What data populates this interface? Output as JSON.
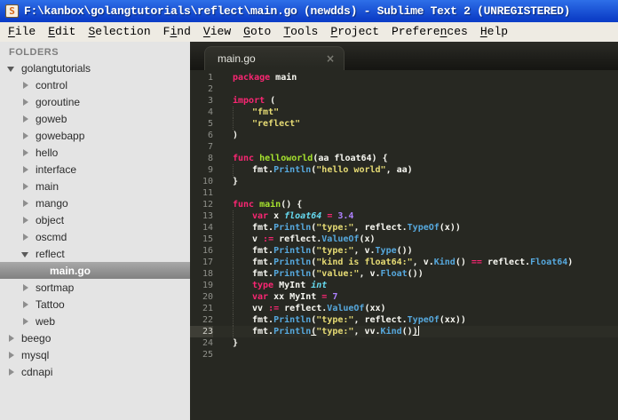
{
  "colors": {
    "titlebar-blue-top": "#2e6fe8",
    "titlebar-blue-bottom": "#0d3fc8",
    "menubar-bg": "#eeebe3",
    "sidebar-bg": "#e4e4e4",
    "sidebar-selected-top": "#a8a8a8",
    "sidebar-selected-bottom": "#818181",
    "editor-bg": "#272822",
    "keyword": "#f92672",
    "string": "#e6db74",
    "function-decl": "#a6e22e",
    "function-call": "#56a8dd",
    "type-italic": "#66d9ef",
    "number": "#ae81ff",
    "default-text": "#f8f8f2",
    "line-number": "#8f908a"
  },
  "window": {
    "icon_letter": "S",
    "title": "F:\\kanbox\\golangtutorials\\reflect\\main.go (newdds) - Sublime Text 2 (UNREGISTERED)"
  },
  "menu": {
    "items": [
      {
        "label": "File",
        "u": 0
      },
      {
        "label": "Edit",
        "u": 0
      },
      {
        "label": "Selection",
        "u": 0
      },
      {
        "label": "Find",
        "u": 1
      },
      {
        "label": "View",
        "u": 0
      },
      {
        "label": "Goto",
        "u": 0
      },
      {
        "label": "Tools",
        "u": 0
      },
      {
        "label": "Project",
        "u": 0
      },
      {
        "label": "Preferences",
        "u": 7
      },
      {
        "label": "Help",
        "u": 0
      }
    ]
  },
  "sidebar": {
    "header": "FOLDERS",
    "items": [
      {
        "label": "golangtutorials",
        "level": 0,
        "state": "expanded"
      },
      {
        "label": "control",
        "level": 1,
        "state": "collapsed"
      },
      {
        "label": "goroutine",
        "level": 1,
        "state": "collapsed"
      },
      {
        "label": "goweb",
        "level": 1,
        "state": "collapsed"
      },
      {
        "label": "gowebapp",
        "level": 1,
        "state": "collapsed"
      },
      {
        "label": "hello",
        "level": 1,
        "state": "collapsed"
      },
      {
        "label": "interface",
        "level": 1,
        "state": "collapsed"
      },
      {
        "label": "main",
        "level": 1,
        "state": "collapsed"
      },
      {
        "label": "mango",
        "level": 1,
        "state": "collapsed"
      },
      {
        "label": "object",
        "level": 1,
        "state": "collapsed"
      },
      {
        "label": "oscmd",
        "level": 1,
        "state": "collapsed"
      },
      {
        "label": "reflect",
        "level": 1,
        "state": "expanded"
      },
      {
        "label": "main.go",
        "level": 2,
        "state": "file",
        "selected": true
      },
      {
        "label": "sortmap",
        "level": 1,
        "state": "collapsed"
      },
      {
        "label": "Tattoo",
        "level": 1,
        "state": "collapsed"
      },
      {
        "label": "web",
        "level": 1,
        "state": "collapsed"
      },
      {
        "label": "beego",
        "level": 0,
        "state": "collapsed"
      },
      {
        "label": "mysql",
        "level": 0,
        "state": "collapsed"
      },
      {
        "label": "cdnapi",
        "level": 0,
        "state": "collapsed"
      }
    ]
  },
  "editor": {
    "tabs": [
      {
        "label": "main.go",
        "close_icon": "×",
        "active": true
      }
    ],
    "code": {
      "lines": [
        {
          "n": 1,
          "tokens": [
            [
              "kw",
              "package"
            ],
            [
              "pl",
              " main"
            ]
          ]
        },
        {
          "n": 2,
          "tokens": []
        },
        {
          "n": 3,
          "tokens": [
            [
              "kw",
              "import"
            ],
            [
              "pl",
              " ("
            ]
          ]
        },
        {
          "n": 4,
          "indent": 1,
          "tokens": [
            [
              "str",
              "\"fmt\""
            ]
          ]
        },
        {
          "n": 5,
          "indent": 1,
          "tokens": [
            [
              "str",
              "\"reflect\""
            ]
          ]
        },
        {
          "n": 6,
          "tokens": [
            [
              "pl",
              ")"
            ]
          ]
        },
        {
          "n": 7,
          "tokens": []
        },
        {
          "n": 8,
          "tokens": [
            [
              "kw",
              "func"
            ],
            [
              "fndecl",
              " helloworld"
            ],
            [
              "pl",
              "(aa float64) {"
            ]
          ]
        },
        {
          "n": 9,
          "indent": 1,
          "tokens": [
            [
              "pl",
              "fmt."
            ],
            [
              "call",
              "Println"
            ],
            [
              "pl",
              "("
            ],
            [
              "str",
              "\"hello world\""
            ],
            [
              "pl",
              ", aa)"
            ]
          ]
        },
        {
          "n": 10,
          "tokens": [
            [
              "pl",
              "}"
            ]
          ]
        },
        {
          "n": 11,
          "tokens": []
        },
        {
          "n": 12,
          "tokens": [
            [
              "kw",
              "func"
            ],
            [
              "fndecl",
              " main"
            ],
            [
              "pl",
              "() {"
            ]
          ]
        },
        {
          "n": 13,
          "indent": 1,
          "tokens": [
            [
              "kw",
              "var"
            ],
            [
              "pl",
              " x "
            ],
            [
              "type",
              "float64"
            ],
            [
              "pl",
              " "
            ],
            [
              "op",
              "="
            ],
            [
              "pl",
              " "
            ],
            [
              "num",
              "3.4"
            ]
          ]
        },
        {
          "n": 14,
          "indent": 1,
          "tokens": [
            [
              "pl",
              "fmt."
            ],
            [
              "call",
              "Println"
            ],
            [
              "pl",
              "("
            ],
            [
              "str",
              "\"type:\""
            ],
            [
              "pl",
              ", reflect."
            ],
            [
              "call",
              "TypeOf"
            ],
            [
              "pl",
              "(x))"
            ]
          ]
        },
        {
          "n": 15,
          "indent": 1,
          "tokens": [
            [
              "pl",
              "v "
            ],
            [
              "op",
              ":="
            ],
            [
              "pl",
              " reflect."
            ],
            [
              "call",
              "ValueOf"
            ],
            [
              "pl",
              "(x)"
            ]
          ]
        },
        {
          "n": 16,
          "indent": 1,
          "tokens": [
            [
              "pl",
              "fmt."
            ],
            [
              "call",
              "Println"
            ],
            [
              "pl",
              "("
            ],
            [
              "str",
              "\"type:\""
            ],
            [
              "pl",
              ", v."
            ],
            [
              "call",
              "Type"
            ],
            [
              "pl",
              "())"
            ]
          ]
        },
        {
          "n": 17,
          "indent": 1,
          "tokens": [
            [
              "pl",
              "fmt."
            ],
            [
              "call",
              "Println"
            ],
            [
              "pl",
              "("
            ],
            [
              "str",
              "\"kind is float64:\""
            ],
            [
              "pl",
              ", v."
            ],
            [
              "call",
              "Kind"
            ],
            [
              "pl",
              "() "
            ],
            [
              "op",
              "=="
            ],
            [
              "pl",
              " reflect."
            ],
            [
              "call",
              "Float64"
            ],
            [
              "pl",
              ")"
            ]
          ]
        },
        {
          "n": 18,
          "indent": 1,
          "tokens": [
            [
              "pl",
              "fmt."
            ],
            [
              "call",
              "Println"
            ],
            [
              "pl",
              "("
            ],
            [
              "str",
              "\"value:\""
            ],
            [
              "pl",
              ", v."
            ],
            [
              "call",
              "Float"
            ],
            [
              "pl",
              "())"
            ]
          ]
        },
        {
          "n": 19,
          "indent": 1,
          "tokens": [
            [
              "kw",
              "type"
            ],
            [
              "pl",
              " MyInt "
            ],
            [
              "type",
              "int"
            ]
          ]
        },
        {
          "n": 20,
          "indent": 1,
          "tokens": [
            [
              "kw",
              "var"
            ],
            [
              "pl",
              " xx MyInt "
            ],
            [
              "op",
              "="
            ],
            [
              "pl",
              " "
            ],
            [
              "num",
              "7"
            ]
          ]
        },
        {
          "n": 21,
          "indent": 1,
          "tokens": [
            [
              "pl",
              "vv "
            ],
            [
              "op",
              ":="
            ],
            [
              "pl",
              " reflect."
            ],
            [
              "call",
              "ValueOf"
            ],
            [
              "pl",
              "(xx)"
            ]
          ]
        },
        {
          "n": 22,
          "indent": 1,
          "tokens": [
            [
              "pl",
              "fmt."
            ],
            [
              "call",
              "Println"
            ],
            [
              "pl",
              "("
            ],
            [
              "str",
              "\"type:\""
            ],
            [
              "pl",
              ", reflect."
            ],
            [
              "call",
              "TypeOf"
            ],
            [
              "pl",
              "(xx))"
            ]
          ]
        },
        {
          "n": 23,
          "indent": 1,
          "current": true,
          "caret": true,
          "tokens": [
            [
              "pl",
              "fmt."
            ],
            [
              "call",
              "Println"
            ],
            [
              "plu",
              "("
            ],
            [
              "str",
              "\"type:\""
            ],
            [
              "pl",
              ", vv."
            ],
            [
              "call",
              "Kind"
            ],
            [
              "pl",
              "()"
            ],
            [
              "plu",
              ")"
            ]
          ]
        },
        {
          "n": 24,
          "tokens": [
            [
              "pl",
              "}"
            ]
          ]
        },
        {
          "n": 25,
          "tokens": []
        }
      ]
    }
  }
}
